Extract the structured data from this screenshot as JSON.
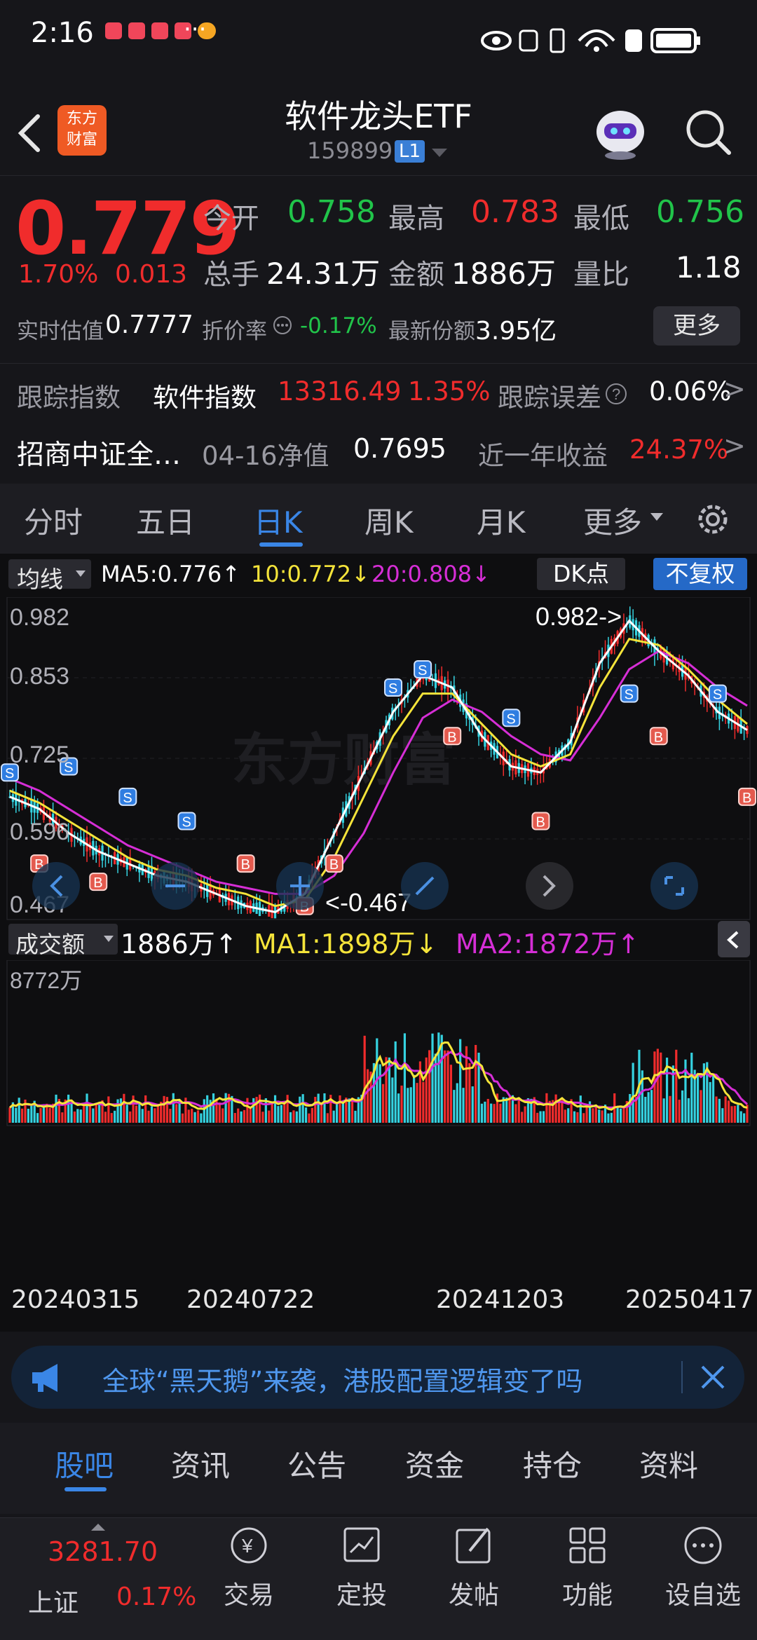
{
  "status_bar": {
    "time": "2:16",
    "more": "···"
  },
  "header": {
    "title": "软件龙头ETF",
    "code": "159899",
    "level": "L1",
    "logo_text_1": "东方",
    "logo_text_2": "财富"
  },
  "quote": {
    "price": "0.779",
    "change_pct": "1.70%",
    "change": "0.013",
    "open_label": "今开",
    "open": "0.758",
    "high_label": "最高",
    "high": "0.783",
    "low_label": "最低",
    "low": "0.756",
    "volume_label": "总手",
    "volume": "24.31万",
    "amount_label": "金额",
    "amount": "1886万",
    "ratio_label": "量比",
    "ratio": "1.18",
    "iopv_label": "实时估值",
    "iopv": "0.7777",
    "discount_label": "折价率",
    "discount": "-0.17%",
    "shares_label": "最新份额",
    "shares": "3.95亿",
    "more_button": "更多"
  },
  "index_row": {
    "label": "跟踪指数",
    "name": "软件指数",
    "value": "13316.49",
    "pct": "1.35%",
    "error_label": "跟踪误差",
    "error": "0.06%"
  },
  "fund_row": {
    "name": "招商中证全…",
    "nav_label": "04-16净值",
    "nav": "0.7695",
    "year_label": "近一年收益",
    "year_return": "24.37%"
  },
  "period_tabs": [
    "分时",
    "五日",
    "日K",
    "周K",
    "月K",
    "更多"
  ],
  "active_period": "日K",
  "chart_toolbar": {
    "ma_select": "均线",
    "ma5": "MA5:0.776↑",
    "ma10": "10:0.772↓",
    "ma20": "20:0.808↓",
    "dk_button": "DK点",
    "adjust_button": "不复权"
  },
  "price_axis": [
    "0.982",
    "0.853",
    "0.725",
    "0.596",
    "0.467"
  ],
  "watermark": "东方财富",
  "annotations": {
    "max": "0.982->",
    "min": "<-0.467"
  },
  "volume_toolbar": {
    "select": "成交额",
    "value": "1886万↑",
    "ma1": "MA1:1898万↓",
    "ma2": "MA2:1872万↑",
    "max_label": "8772万"
  },
  "date_axis": [
    "20240315",
    "20240722",
    "20241203",
    "20250417"
  ],
  "banner": {
    "text": "全球“黑天鹅”来袭，港股配置逻辑变了吗"
  },
  "bottom_tabs": [
    "股吧",
    "资讯",
    "公告",
    "资金",
    "持仓",
    "资料"
  ],
  "active_bottom_tab": "股吧",
  "bottom_nav": {
    "index_value": "3281.70",
    "index_name": "上证",
    "index_pct": "0.17%",
    "items": [
      "交易",
      "定投",
      "发帖",
      "功能",
      "设自选"
    ]
  },
  "colors": {
    "up": "#f02c2c",
    "down": "#21c44a",
    "accent": "#3a86e6",
    "ma5": "#ffffff",
    "ma10": "#f5e43a",
    "ma20": "#d62ed6"
  },
  "chart_data": {
    "type": "candlestick",
    "ylim": [
      0.467,
      0.982
    ],
    "series": [
      {
        "name": "MA5",
        "values": [
          0.66,
          0.64,
          0.6,
          0.57,
          0.55,
          0.53,
          0.52,
          0.5,
          0.48,
          0.47,
          0.5,
          0.6,
          0.7,
          0.8,
          0.86,
          0.84,
          0.76,
          0.71,
          0.7,
          0.75,
          0.88,
          0.95,
          0.9,
          0.86,
          0.8,
          0.77
        ]
      },
      {
        "name": "10",
        "values": [
          0.67,
          0.65,
          0.62,
          0.59,
          0.56,
          0.54,
          0.53,
          0.51,
          0.5,
          0.48,
          0.49,
          0.56,
          0.66,
          0.76,
          0.83,
          0.83,
          0.78,
          0.73,
          0.71,
          0.73,
          0.84,
          0.92,
          0.91,
          0.87,
          0.82,
          0.78
        ]
      },
      {
        "name": "20",
        "values": [
          0.69,
          0.67,
          0.64,
          0.61,
          0.58,
          0.56,
          0.54,
          0.52,
          0.51,
          0.5,
          0.5,
          0.53,
          0.6,
          0.7,
          0.79,
          0.82,
          0.8,
          0.76,
          0.73,
          0.72,
          0.79,
          0.87,
          0.9,
          0.88,
          0.84,
          0.81
        ]
      }
    ]
  }
}
